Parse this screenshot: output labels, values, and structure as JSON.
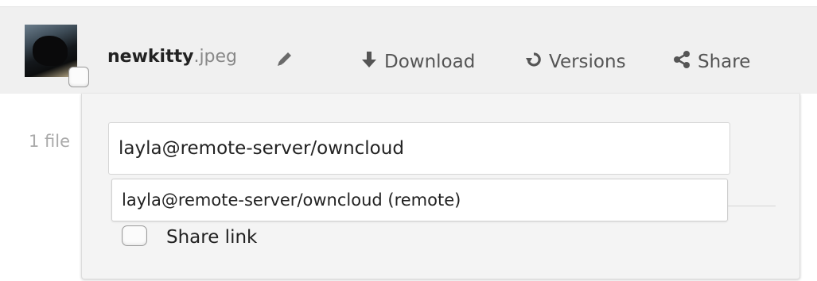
{
  "file": {
    "basename": "newkitty",
    "extension": ".jpeg"
  },
  "actions": {
    "download_label": "Download",
    "versions_label": "Versions",
    "share_label": "Share"
  },
  "summary": {
    "text": "1 file"
  },
  "share": {
    "input_value": "layla@remote-server/owncloud",
    "suggestion": "layla@remote-server/owncloud (remote)",
    "share_link_label": "Share link",
    "share_link_checked": false
  },
  "icons": {
    "rename": "pencil-icon",
    "download": "download-arrow-icon",
    "versions": "history-icon",
    "share": "share-icon"
  },
  "colors": {
    "selected_row": "#f0f0f0",
    "panel_bg": "#f4f4f4",
    "muted_text": "#888888",
    "action_text": "#555555"
  }
}
